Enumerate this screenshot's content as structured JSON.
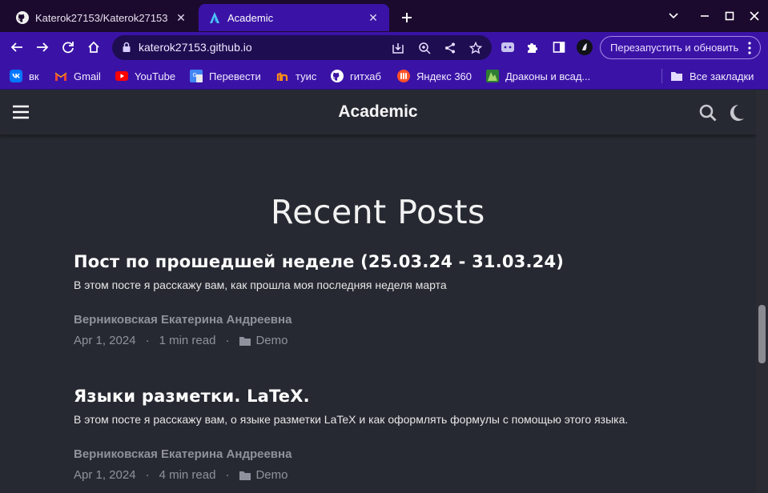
{
  "browser": {
    "tabs": [
      {
        "title": "Katerok27153/Katerok27153",
        "favicon": "github-icon",
        "active": false
      },
      {
        "title": "Academic",
        "favicon": "academic-logo-icon",
        "active": true
      }
    ],
    "url": "katerok27153.github.io",
    "relaunch_label": "Перезапустить и обновить",
    "bookmarks": [
      {
        "label": "вк",
        "icon": "vk-icon"
      },
      {
        "label": "Gmail",
        "icon": "gmail-icon"
      },
      {
        "label": "YouTube",
        "icon": "youtube-icon"
      },
      {
        "label": "Перевести",
        "icon": "translate-icon"
      },
      {
        "label": "туис",
        "icon": "tuis-icon"
      },
      {
        "label": "гитхаб",
        "icon": "github-icon"
      },
      {
        "label": "Яндекс 360",
        "icon": "yandex360-icon"
      },
      {
        "label": "Драконы и всад...",
        "icon": "dragons-icon"
      }
    ],
    "all_bookmarks_label": "Все закладки"
  },
  "site": {
    "brand": "Academic",
    "section_title": "Recent Posts",
    "posts": [
      {
        "title": "Пост по прошедшей неделе (25.03.24 - 31.03.24)",
        "summary": "В этом посте я расскажу вам, как прошла моя последняя неделя марта",
        "author": "Верниковская Екатерина Андреевна",
        "date": "Apr 1, 2024",
        "read_time": "1 min read",
        "category": "Demo"
      },
      {
        "title": "Языки разметки. LaTeX.",
        "summary": "В этом посте я расскажу вам, о языке разметки LaTeX и как оформлять формулы с помощью этого языка.",
        "author": "Верниковская Екатерина Андреевна",
        "date": "Apr 1, 2024",
        "read_time": "4 min read",
        "category": "Demo"
      }
    ],
    "meta_separator": "·"
  },
  "colors": {
    "tab_strip": "#1c0a2e",
    "browser_accent": "#3a13a6",
    "page_background": "#272932",
    "meta_text": "#8f919c"
  }
}
